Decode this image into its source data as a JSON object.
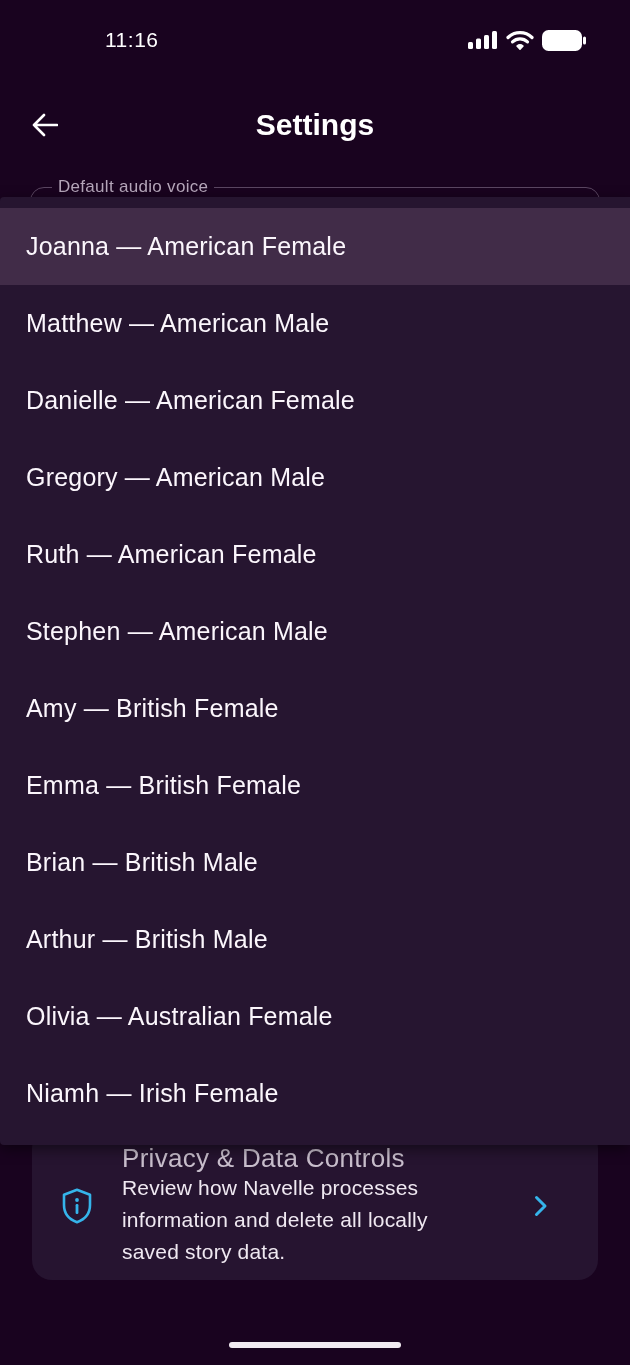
{
  "status_bar": {
    "time": "11:16"
  },
  "app_bar": {
    "title": "Settings"
  },
  "voice_field": {
    "label": "Default audio voice",
    "expanded": true,
    "options": [
      {
        "label": "Joanna — American Female",
        "selected": true
      },
      {
        "label": "Matthew — American Male",
        "selected": false
      },
      {
        "label": "Danielle — American Female",
        "selected": false
      },
      {
        "label": "Gregory — American Male",
        "selected": false
      },
      {
        "label": "Ruth — American Female",
        "selected": false
      },
      {
        "label": "Stephen — American Male",
        "selected": false
      },
      {
        "label": "Amy — British Female",
        "selected": false
      },
      {
        "label": "Emma — British Female",
        "selected": false
      },
      {
        "label": "Brian — British Male",
        "selected": false
      },
      {
        "label": "Arthur — British Male",
        "selected": false
      },
      {
        "label": "Olivia — Australian Female",
        "selected": false
      },
      {
        "label": "Niamh — Irish Female",
        "selected": false
      }
    ]
  },
  "privacy_card": {
    "title": "Privacy & Data Controls",
    "description": "Review how Navelle processes information and delete all locally saved story data."
  }
}
